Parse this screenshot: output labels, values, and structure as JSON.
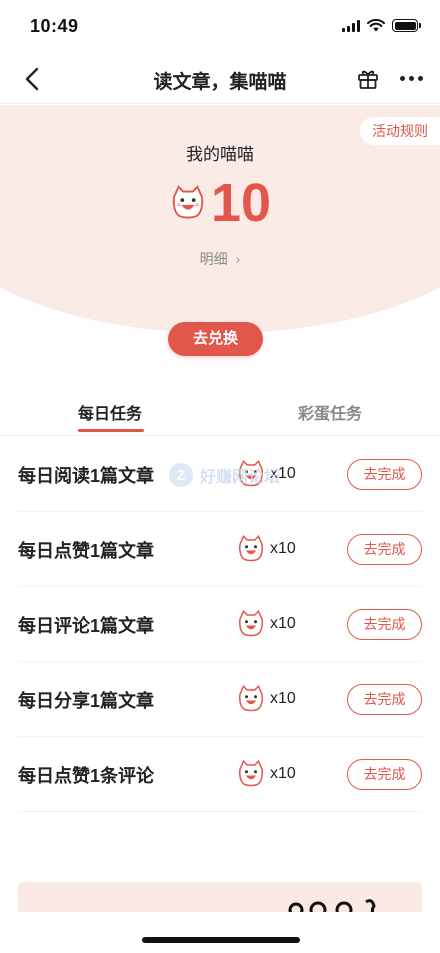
{
  "status_bar": {
    "time": "10:49"
  },
  "nav": {
    "title": "读文章，集喵喵"
  },
  "hero": {
    "rules_label": "活动规则",
    "label": "我的喵喵",
    "count": "10",
    "detail_label": "明细"
  },
  "redeem_label": "去兑换",
  "tabs": [
    {
      "label": "每日任务"
    },
    {
      "label": "彩蛋任务"
    }
  ],
  "tasks": [
    {
      "title": "每日阅读1篇文章",
      "reward": "x10",
      "action": "去完成"
    },
    {
      "title": "每日点赞1篇文章",
      "reward": "x10",
      "action": "去完成"
    },
    {
      "title": "每日评论1篇文章",
      "reward": "x10",
      "action": "去完成"
    },
    {
      "title": "每日分享1篇文章",
      "reward": "x10",
      "action": "去完成"
    },
    {
      "title": "每日点赞1条评论",
      "reward": "x10",
      "action": "去完成"
    }
  ],
  "watermark": {
    "text": "好赚网论坛"
  },
  "colors": {
    "accent": "#e2574c",
    "hero_bg": "#fbebe7"
  }
}
